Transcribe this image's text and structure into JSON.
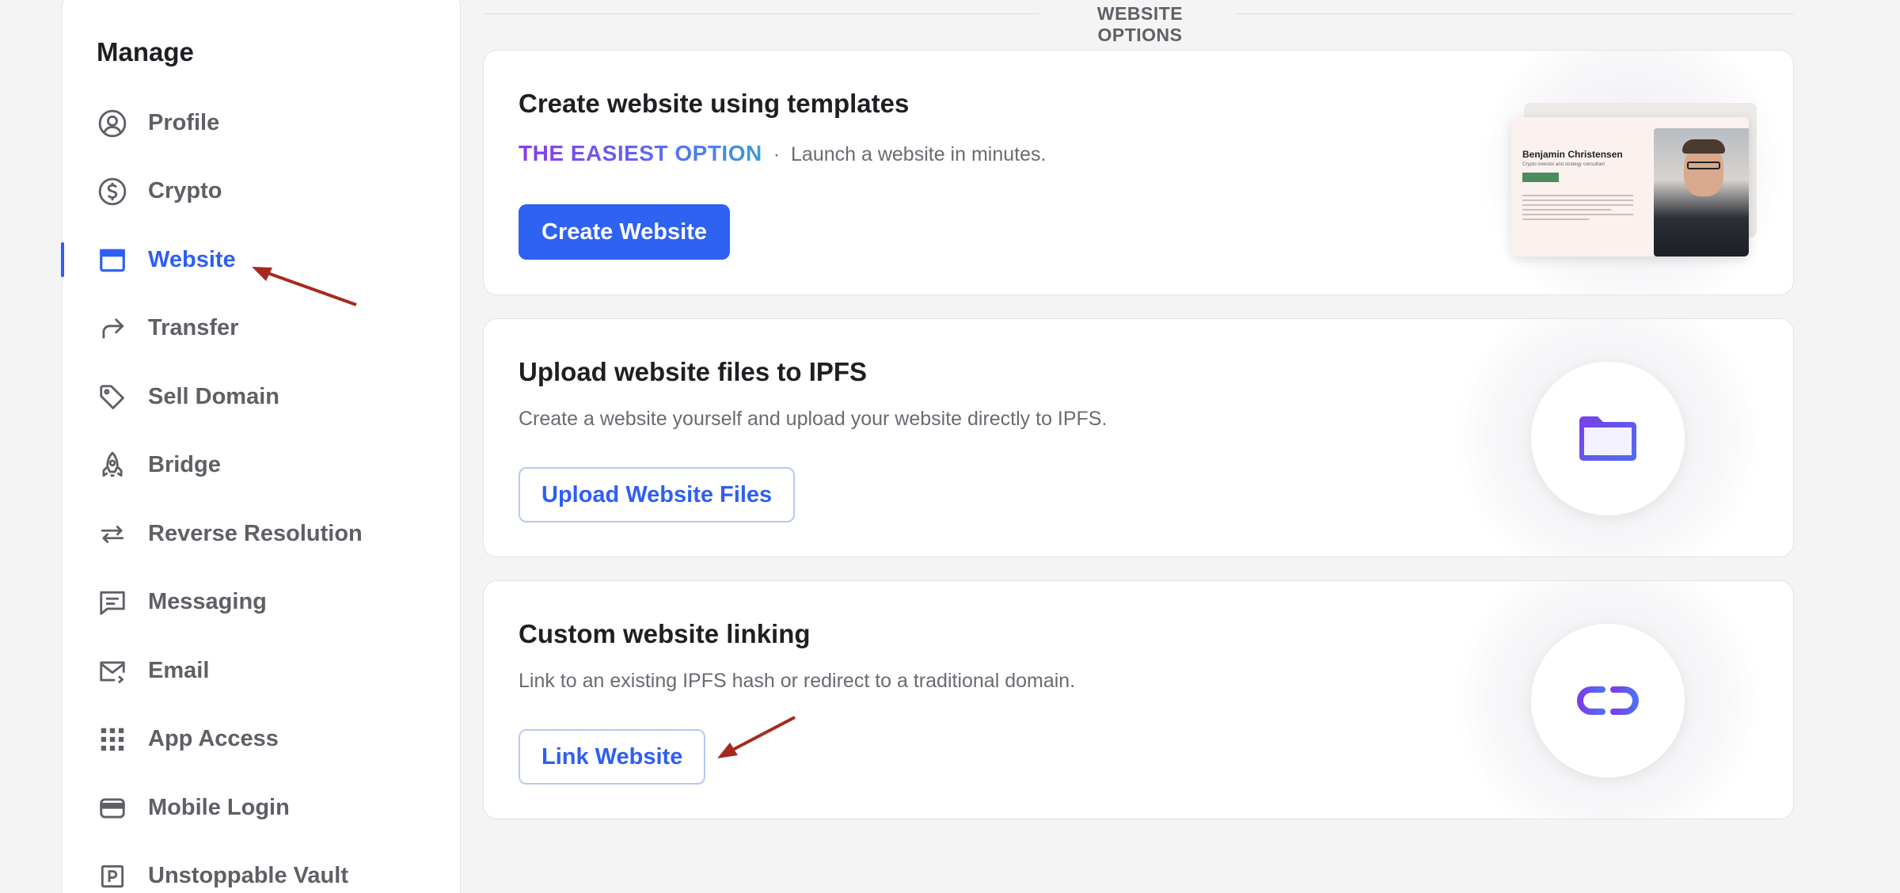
{
  "sidebar": {
    "title": "Manage",
    "items": [
      {
        "label": "Profile",
        "icon": "user-circle-icon",
        "active": false
      },
      {
        "label": "Crypto",
        "icon": "dollar-circle-icon",
        "active": false
      },
      {
        "label": "Website",
        "icon": "browser-window-icon",
        "active": true
      },
      {
        "label": "Transfer",
        "icon": "share-arrow-icon",
        "active": false
      },
      {
        "label": "Sell Domain",
        "icon": "tag-icon",
        "active": false
      },
      {
        "label": "Bridge",
        "icon": "rocket-icon",
        "active": false
      },
      {
        "label": "Reverse Resolution",
        "icon": "swap-arrows-icon",
        "active": false
      },
      {
        "label": "Messaging",
        "icon": "chat-icon",
        "active": false
      },
      {
        "label": "Email",
        "icon": "mail-icon",
        "active": false
      },
      {
        "label": "App Access",
        "icon": "grid-icon",
        "active": false
      },
      {
        "label": "Mobile Login",
        "icon": "wallet-icon",
        "active": false
      },
      {
        "label": "Unstoppable Vault",
        "icon": "vault-icon",
        "active": false
      }
    ]
  },
  "main": {
    "section_title": "WEBSITE OPTIONS",
    "cards": [
      {
        "title": "Create website using templates",
        "highlight": "THE EASIEST OPTION",
        "separator": "·",
        "description": "Launch a website in minutes.",
        "button": "Create Website"
      },
      {
        "title": "Upload website files to IPFS",
        "description": "Create a website yourself and upload your website directly to IPFS.",
        "button": "Upload Website Files"
      },
      {
        "title": "Custom website linking",
        "description": "Link to an existing IPFS hash or redirect to a traditional domain.",
        "button": "Link Website"
      }
    ],
    "template_preview": {
      "name": "Benjamin Christensen",
      "subtitle": "Crypto investor and strategy consultant"
    }
  },
  "colors": {
    "accent": "#2e5ff2",
    "annotation_arrow": "#a52a1e"
  }
}
